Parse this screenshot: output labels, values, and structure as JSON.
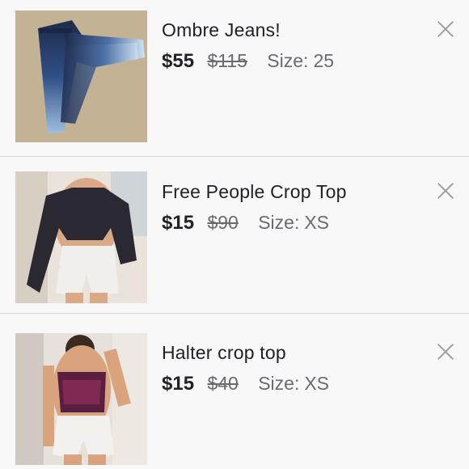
{
  "items": [
    {
      "title": "Ombre Jeans!",
      "price": "$55",
      "original_price": "$115",
      "size_label": "Size:",
      "size": "25",
      "image": "ombre-jeans-photo",
      "close_icon": "close-icon"
    },
    {
      "title": "Free People Crop Top",
      "price": "$15",
      "original_price": "$90",
      "size_label": "Size:",
      "size": "XS",
      "image": "crop-top-photo",
      "close_icon": "close-icon"
    },
    {
      "title": "Halter crop top",
      "price": "$15",
      "original_price": "$40",
      "size_label": "Size:",
      "size": "XS",
      "image": "halter-top-photo",
      "close_icon": "close-icon"
    }
  ],
  "colors": {
    "background": "#f9f8f9",
    "text_primary": "#232126",
    "text_secondary": "#6c6970",
    "divider": "#d9d7da",
    "close_icon": "#a19ea5"
  }
}
